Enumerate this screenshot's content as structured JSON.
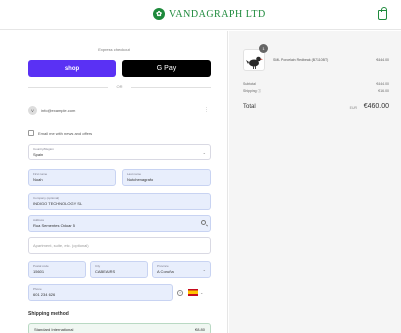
{
  "header": {
    "brand": "VANDAGRAPH LTD",
    "logo_icon": "leaf-logo",
    "cart_icon": "shopping-bag-icon"
  },
  "express": {
    "title": "Express checkout",
    "shop_label": "shop",
    "gpay_label": "G Pay",
    "or_label": "OR"
  },
  "account": {
    "initial": "V",
    "email": "info@example.com",
    "menu_icon": "more-vertical-icon"
  },
  "newsletter": {
    "label": "Email me with news and offers",
    "checked": false
  },
  "delivery": {
    "country": {
      "label": "Country/Region",
      "value": "Spain"
    },
    "first_name": {
      "label": "First name",
      "value": "Noah"
    },
    "last_name": {
      "label": "Last name",
      "value": "Nutchenagrafo"
    },
    "company": {
      "label": "Company (optional)",
      "value": "INDIGO TECHNOLOGY SL"
    },
    "address": {
      "label": "Address",
      "value": "Rua Sementes Odoar 5"
    },
    "apartment": {
      "placeholder": "Apartment, suite, etc. (optional)"
    },
    "postal_code": {
      "label": "Postal code",
      "value": "15601"
    },
    "city": {
      "label": "City",
      "value": "CABEAIRS"
    },
    "province": {
      "label": "Province",
      "value": "A Coruña"
    },
    "phone": {
      "label": "Phone",
      "value": "601 234 626"
    }
  },
  "shipping": {
    "title": "Shipping method",
    "option_name": "Standard International",
    "option_price": "€8.80"
  },
  "summary": {
    "quantity": "1",
    "product_name": "SML Porcelain Redbeak (B7110BT)",
    "product_price": "€444.00",
    "subtotal_label": "Subtotal",
    "subtotal_value": "€444.00",
    "shipping_label": "Shipping ⓘ",
    "shipping_value": "€16.00",
    "total_label": "Total",
    "currency": "EUR",
    "total_value": "€460.00"
  },
  "colors": {
    "brand_green": "#1e8a3c",
    "shop_purple": "#5a31f4",
    "gpay_black": "#000000"
  }
}
